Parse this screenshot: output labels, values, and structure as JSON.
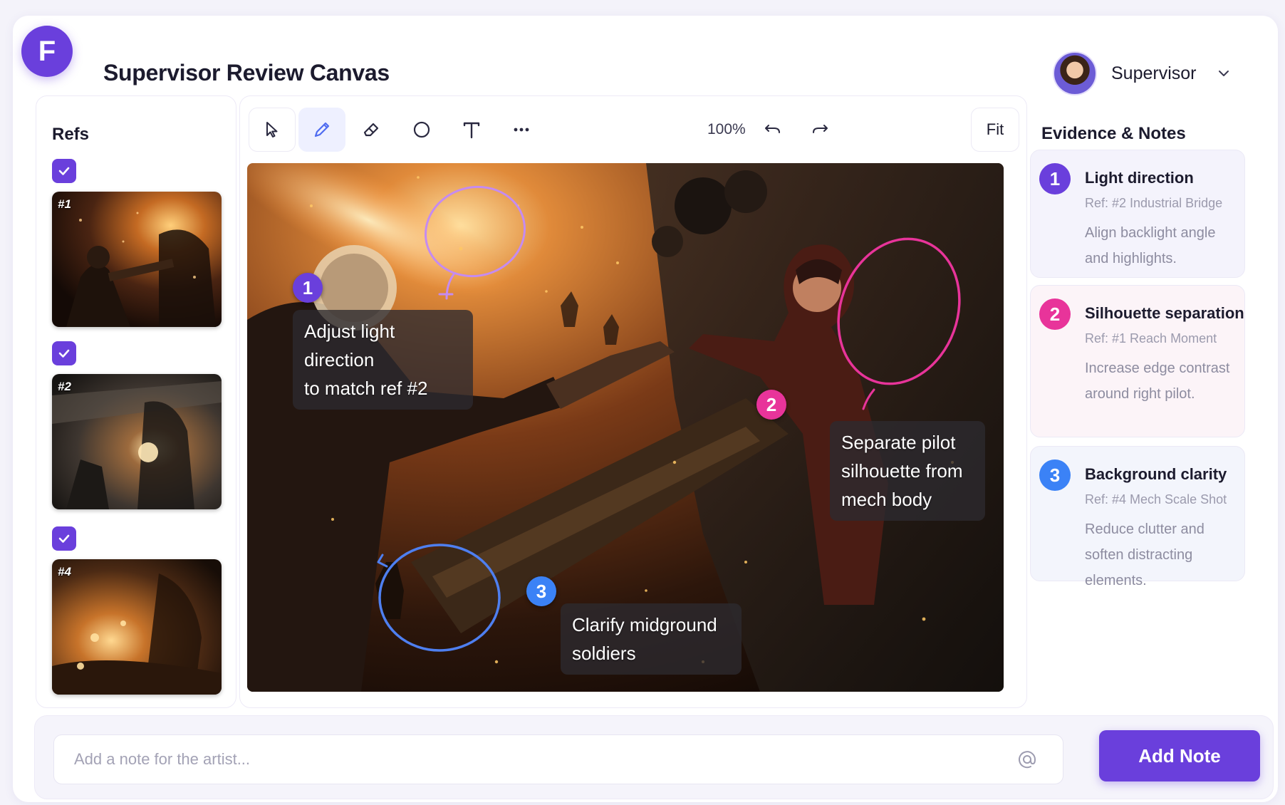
{
  "app": {
    "logo_letter": "F",
    "title": "Supervisor Review Canvas",
    "user_name": "Supervisor"
  },
  "refs": {
    "title": "Refs",
    "items": [
      {
        "tag": "#1",
        "checked": true
      },
      {
        "tag": "#2",
        "checked": true
      },
      {
        "tag": "#4",
        "checked": true
      }
    ]
  },
  "toolbar": {
    "tools": [
      "select-arrow-icon",
      "pen-icon",
      "eraser-icon",
      "circle-icon",
      "text-icon",
      "more-icon"
    ],
    "active_tool": "pen-icon",
    "zoom": "100%",
    "fit_label": "Fit"
  },
  "canvas": {
    "annotations": [
      {
        "number": "1",
        "text_line1": "Adjust light direction",
        "text_line2": "to match ref #2",
        "color": "#6a3fdc"
      },
      {
        "number": "2",
        "text_line1": "Separate pilot",
        "text_line2": "silhouette from",
        "text_line3": "mech body",
        "color": "#e8349a"
      },
      {
        "number": "3",
        "text_line1": "Clarify midground",
        "text_line2": "soldiers",
        "color": "#3b82f6"
      }
    ]
  },
  "notes": {
    "title": "Evidence & Notes",
    "cards": [
      {
        "number": "1",
        "title": "Light direction",
        "ref": "Ref: #2 Industrial Bridge",
        "text": "Align backlight angle and highlights.",
        "color": "#6a3fdc",
        "bg": "#f4f3fc"
      },
      {
        "number": "2",
        "title": "Silhouette separation",
        "ref": "Ref: #1 Reach Moment",
        "text": "Increase edge contrast around right pilot.",
        "color": "#e8349a",
        "bg": "#fcf4f8"
      },
      {
        "number": "3",
        "title": "Background clarity",
        "ref": "Ref: #4 Mech Scale Shot",
        "text": "Reduce clutter and soften distracting elements.",
        "color": "#3b82f6",
        "bg": "#f3f5fc"
      }
    ]
  },
  "composer": {
    "placeholder": "Add a note for the artist...",
    "button_label": "Add Note"
  }
}
